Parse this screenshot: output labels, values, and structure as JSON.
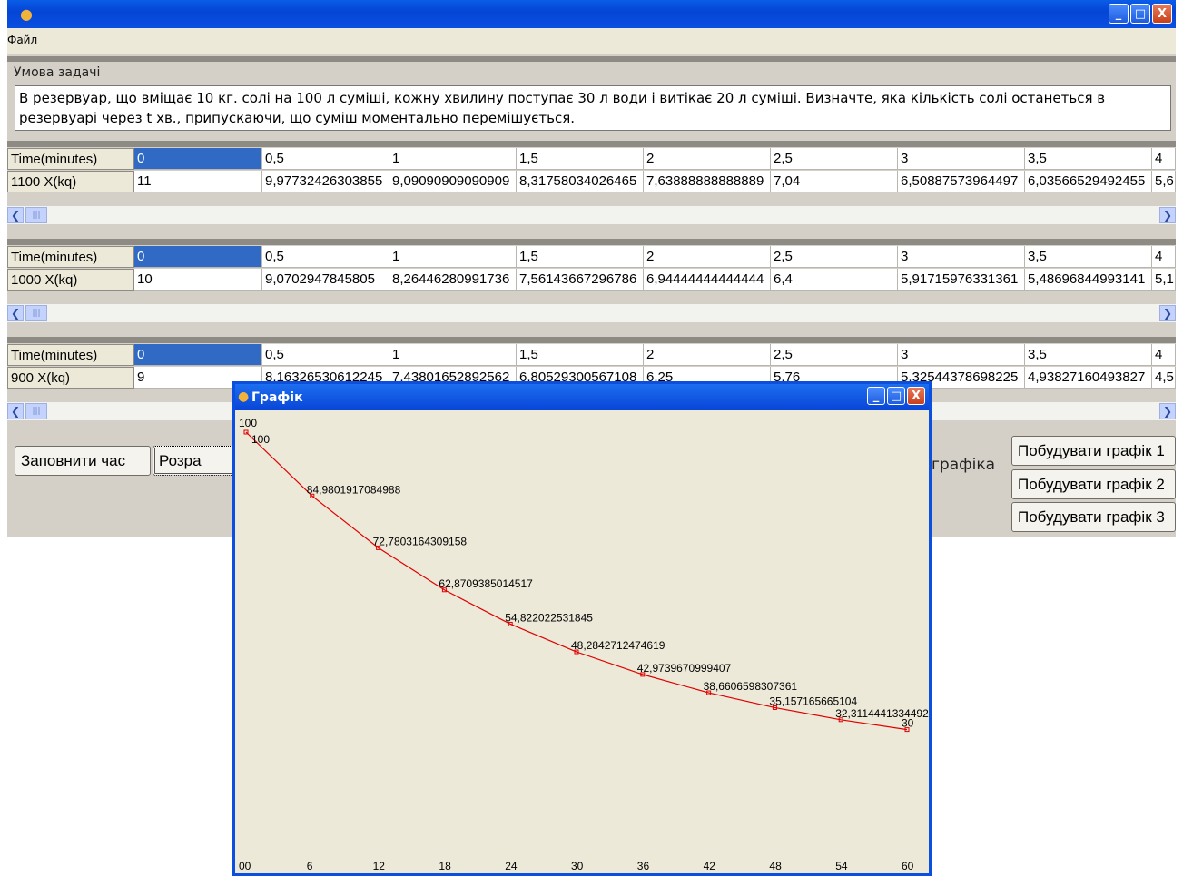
{
  "window": {
    "icon": "app-icon",
    "controls": {
      "minimize": "_",
      "maximize": "□",
      "close": "X"
    }
  },
  "menu": {
    "file": "Файл"
  },
  "task": {
    "label": "Умова задачі",
    "text": "В резервуар, що вміщає 10 кг. солі на 100 л суміші, кожну хвилину поступає 30 л води і витікає 20 л суміші. Визначте, яка кількість солі останеться в резервуарі через t хв., припускаючи, що суміш моментально перемішується."
  },
  "grids": [
    {
      "time_label": "Time(minutes)",
      "x_label": "1100 X(kq)",
      "times": [
        "0",
        "0,5",
        "1",
        "1,5",
        "2",
        "2,5",
        "3",
        "3,5",
        "4"
      ],
      "values": [
        "11",
        "9,97732426303855",
        "9,09090909090909",
        "8,31758034026465",
        "7,63888888888889",
        "7,04",
        "6,50887573964497",
        "6,03566529492455",
        "5,6"
      ]
    },
    {
      "time_label": "Time(minutes)",
      "x_label": "1000 X(kq)",
      "times": [
        "0",
        "0,5",
        "1",
        "1,5",
        "2",
        "2,5",
        "3",
        "3,5",
        "4"
      ],
      "values": [
        "10",
        "9,0702947845805",
        "8,26446280991736",
        "7,56143667296786",
        "6,94444444444444",
        "6,4",
        "5,91715976331361",
        "5,48696844993141",
        "5,1"
      ]
    },
    {
      "time_label": "Time(minutes)",
      "x_label": "900 X(kq)",
      "times": [
        "0",
        "0,5",
        "1",
        "1,5",
        "2",
        "2,5",
        "3",
        "3,5",
        "4"
      ],
      "values": [
        "9",
        "8,16326530612245",
        "7,43801652892562",
        "6,80529300567108",
        "6,25",
        "5,76",
        "5,32544378698225",
        "4,93827160493827",
        "4,5"
      ]
    }
  ],
  "buttons": {
    "fill_time": "Заповнити час",
    "calculate": "Розра",
    "graph_label": "графіка",
    "graph1": "Побудувати графік 1",
    "graph2": "Побудувати графік 2",
    "graph3": "Побудувати графік 3"
  },
  "chart_window": {
    "title": "Графік",
    "icon": "app-icon"
  },
  "chart_data": {
    "type": "line",
    "x": [
      0,
      6,
      12,
      18,
      24,
      30,
      36,
      42,
      48,
      54,
      60
    ],
    "x_tick_labels": [
      "00",
      "6",
      "12",
      "18",
      "24",
      "30",
      "36",
      "42",
      "48",
      "54",
      "60"
    ],
    "values": [
      100,
      84.9801917084988,
      72.7803164309158,
      62.8709385014517,
      54.822022531845,
      48.2842712474619,
      42.9739670999407,
      38.6606598307361,
      35.157165665104,
      32.3114441334492,
      30
    ],
    "point_labels": [
      "100",
      "84,9801917084988",
      "72,7803164309158",
      "62,8709385014517",
      "54,822022531845",
      "48,2842712474619",
      "42,9739670999407",
      "38,6606598307361",
      "35,157165665104",
      "32,3114441334492",
      "30"
    ],
    "y_top_label": "100",
    "color": "#e00000",
    "xlim": [
      0,
      60
    ],
    "ylim": [
      0,
      100
    ],
    "grid": false
  }
}
